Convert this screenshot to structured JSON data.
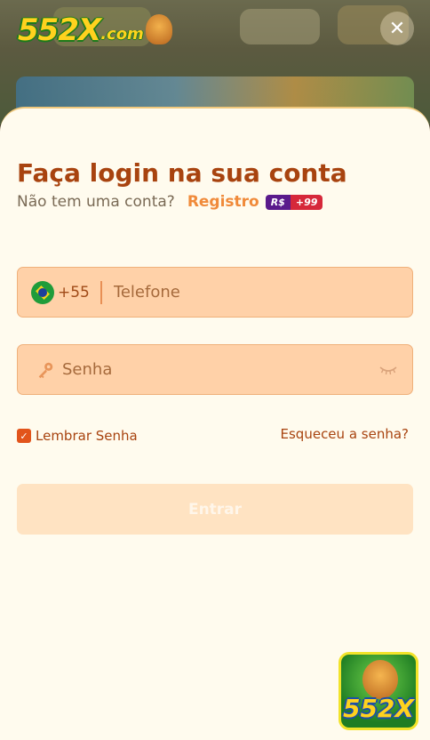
{
  "header": {
    "logo_text": "552X",
    "logo_suffix": ".com",
    "close_symbol": "✕"
  },
  "login": {
    "title": "Faça login na sua conta",
    "no_account_text": "Não tem uma conta?",
    "register_label": "Registro",
    "bonus_currency": "R$",
    "bonus_amount": "+99"
  },
  "phone": {
    "country_code": "+55",
    "placeholder": "Telefone",
    "value": ""
  },
  "password": {
    "placeholder": "Senha",
    "value": ""
  },
  "options": {
    "remember_label": "Lembrar Senha",
    "remember_checked": true,
    "forgot_label": "Esqueceu a senha?"
  },
  "submit_label": "Entrar",
  "app_badge_text": "552X",
  "colors": {
    "accent": "#a8430f",
    "link": "#f08a3a",
    "field_bg": "#ffd1a8",
    "sheet_bg": "#fffbee",
    "checkbox": "#e2541b"
  },
  "icons": [
    "close-icon",
    "brazil-flag-icon",
    "key-icon",
    "eye-closed-icon",
    "check-icon"
  ]
}
